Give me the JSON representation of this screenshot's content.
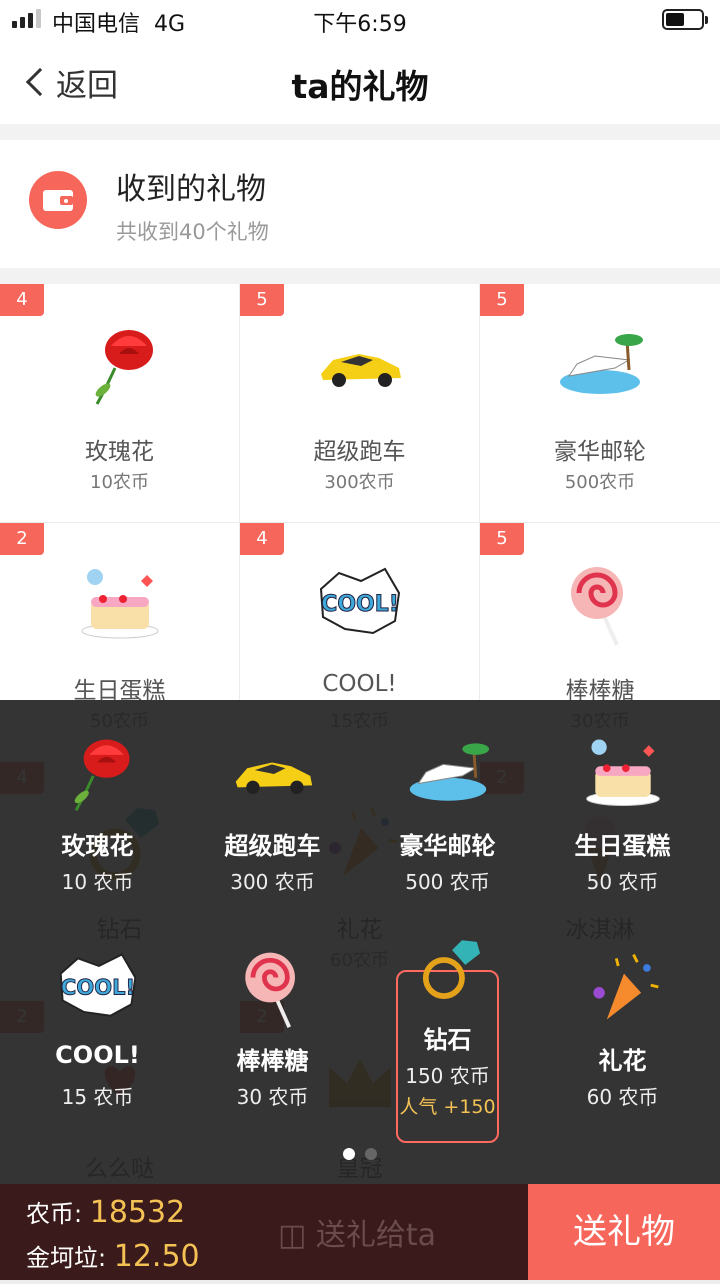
{
  "status": {
    "carrier": "中国电信",
    "network": "4G",
    "time": "下午6:59"
  },
  "nav": {
    "back_label": "返回",
    "title": "ta的礼物"
  },
  "summary": {
    "title": "收到的礼物",
    "subtitle": "共收到40个礼物"
  },
  "received_gifts": [
    {
      "count": "4",
      "name": "玫瑰花",
      "price": "10农币",
      "icon": "rose-icon"
    },
    {
      "count": "5",
      "name": "超级跑车",
      "price": "300农币",
      "icon": "sports-car-icon"
    },
    {
      "count": "5",
      "name": "豪华邮轮",
      "price": "500农币",
      "icon": "cruise-ship-icon"
    },
    {
      "count": "2",
      "name": "生日蛋糕",
      "price": "50农币",
      "icon": "birthday-cake-icon"
    },
    {
      "count": "4",
      "name": "COOL!",
      "price": "15农币",
      "icon": "cool-icon"
    },
    {
      "count": "5",
      "name": "棒棒糖",
      "price": "30农币",
      "icon": "lollipop-icon"
    },
    {
      "count": "4",
      "name": "钻石",
      "price": "",
      "icon": "diamond-ring-icon"
    },
    {
      "count": "",
      "name": "礼花",
      "price": "60农币",
      "icon": "party-popper-icon"
    },
    {
      "count": "2",
      "name": "冰淇淋",
      "price": "",
      "icon": "ice-cream-icon"
    },
    {
      "count": "2",
      "name": "么么哒",
      "price": "",
      "icon": "kiss-icon"
    },
    {
      "count": "2",
      "name": "皇冠",
      "price": "",
      "icon": "crown-icon"
    },
    {
      "count": "",
      "name": "",
      "price": "",
      "icon": ""
    }
  ],
  "picker_gifts": [
    {
      "name": "玫瑰花",
      "price": "10 农币",
      "icon": "rose-icon"
    },
    {
      "name": "超级跑车",
      "price": "300 农币",
      "icon": "sports-car-icon"
    },
    {
      "name": "豪华邮轮",
      "price": "500 农币",
      "icon": "cruise-ship-icon"
    },
    {
      "name": "生日蛋糕",
      "price": "50 农币",
      "icon": "birthday-cake-icon"
    },
    {
      "name": "COOL!",
      "price": "15 农币",
      "icon": "cool-icon"
    },
    {
      "name": "棒棒糖",
      "price": "30 农币",
      "icon": "lollipop-icon"
    },
    {
      "name": "钻石",
      "price": "150 农币",
      "popularity": "人气 +150",
      "icon": "diamond-ring-icon",
      "selected": true
    },
    {
      "name": "礼花",
      "price": "60 农币",
      "icon": "party-popper-icon"
    }
  ],
  "pager": {
    "pages": 2,
    "current": 1
  },
  "wallet": {
    "coin_label": "农币:",
    "coin_value": "18532",
    "gold_label": "金坷垃:",
    "gold_value": "12.50"
  },
  "actions": {
    "ghost_send_label": "送礼给ta",
    "send_label": "送礼物"
  },
  "colors": {
    "accent": "#f7665b",
    "gold": "#f4c155",
    "overlay": "#232323"
  }
}
